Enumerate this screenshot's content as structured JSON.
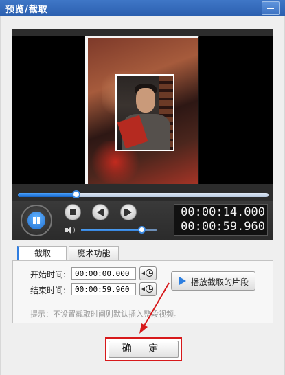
{
  "window": {
    "title": "预览/截取",
    "minimize_icon": "minimize-icon"
  },
  "player": {
    "seek_progress_fraction": 0.233,
    "volume_fraction": 0.8,
    "current_time": "00:00:14.000",
    "total_time": "00:00:59.960",
    "icons": {
      "pause": "pause-icon",
      "stop": "stop-icon",
      "prev": "previous-icon",
      "next": "next-icon",
      "volume": "volume-icon"
    }
  },
  "tabs": [
    {
      "label": "截取",
      "active": true
    },
    {
      "label": "魔术功能",
      "active": false
    }
  ],
  "clip": {
    "start_label": "开始时间:",
    "start_value": "00:00:00.000",
    "end_label": "结束时间:",
    "end_value": "00:00:59.960",
    "set_time_icon": "clock-set-icon",
    "play_segment_label": "播放截取的片段",
    "hint": "提示：不设置截取时间则默认插入整段视频。"
  },
  "confirm_label": "确 定",
  "colors": {
    "titlebar": "#2f64b4",
    "accent": "#2f7de0",
    "highlight": "#d7191b"
  }
}
